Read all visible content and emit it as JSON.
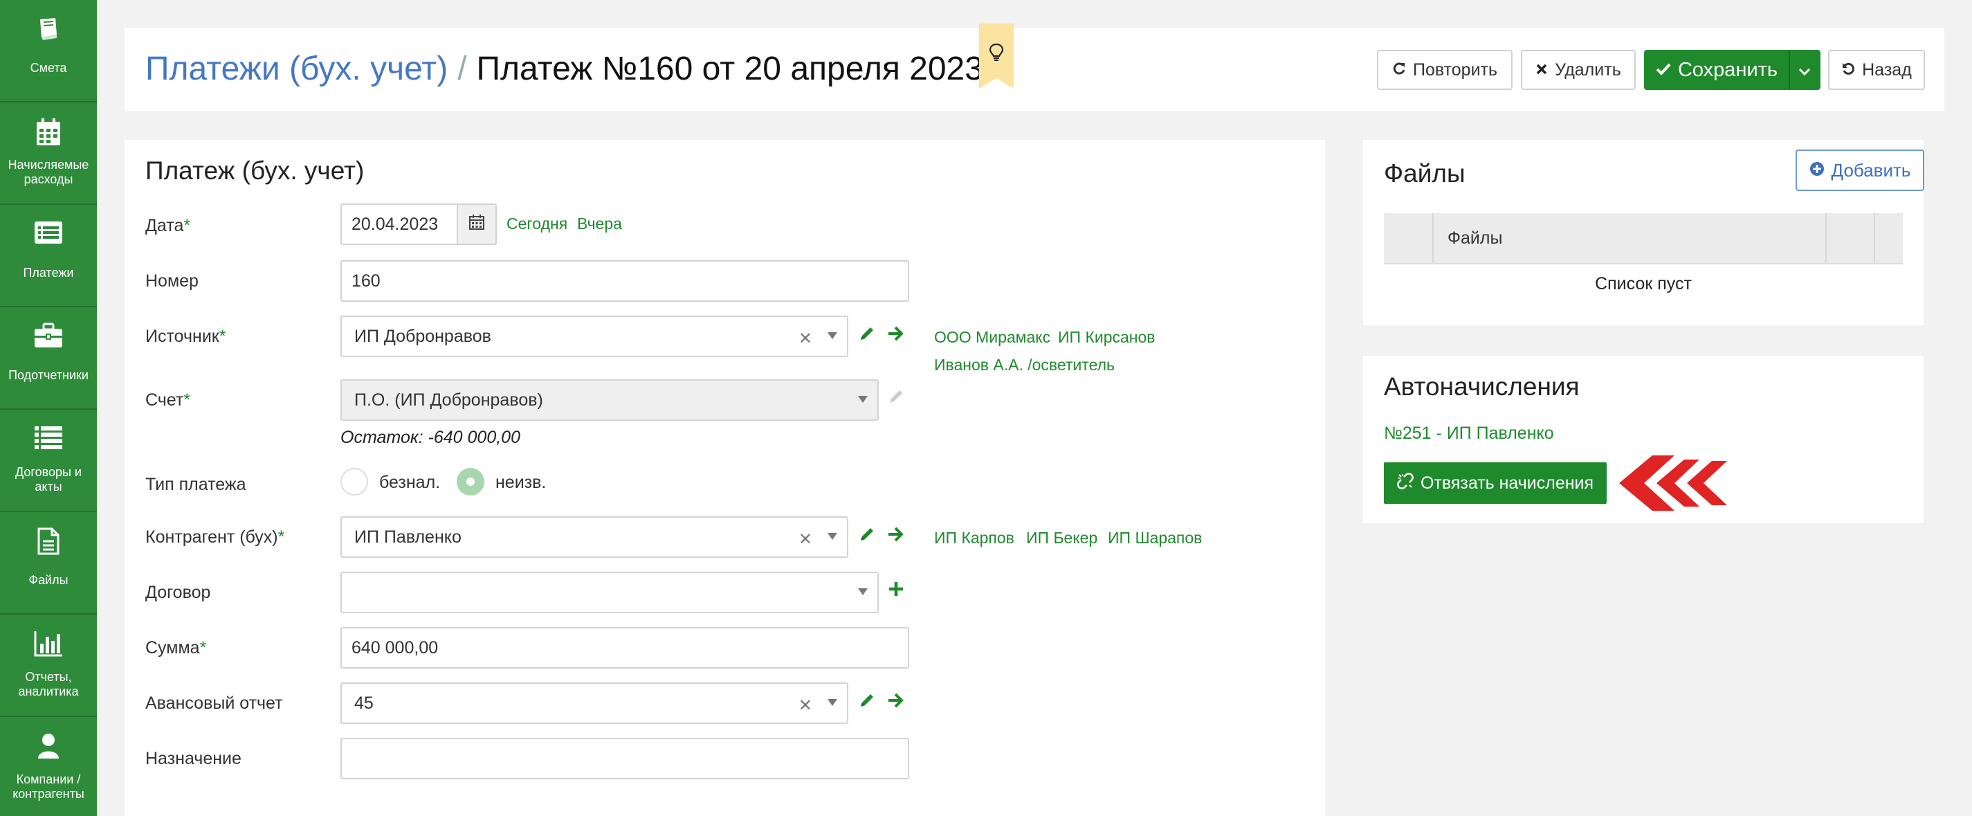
{
  "sidebar": {
    "items": [
      {
        "icon": "book-icon",
        "label": "Смета"
      },
      {
        "icon": "calendar-icon",
        "label": "Начисляемые расходы"
      },
      {
        "icon": "list-card-icon",
        "label": "Платежи"
      },
      {
        "icon": "briefcase-icon",
        "label": "Подотчетники"
      },
      {
        "icon": "list-icon",
        "label": "Договоры и акты"
      },
      {
        "icon": "file-icon",
        "label": "Файлы"
      },
      {
        "icon": "bar-chart-icon",
        "label": "Отчеты, аналитика"
      },
      {
        "icon": "user-icon",
        "label": "Компании / контрагенты"
      }
    ]
  },
  "header": {
    "breadcrumb_link": "Платежи (бух. учет)",
    "separator": "/",
    "title": "Платеж №160 от 20 апреля 2023",
    "buttons": {
      "repeat": "Повторить",
      "delete": "Удалить",
      "save": "Сохранить",
      "back": "Назад"
    }
  },
  "form": {
    "title": "Платеж (бух. учет)",
    "required_mark": "*",
    "date": {
      "label": "Дата",
      "value": "20.04.2023",
      "today": "Сегодня",
      "yesterday": "Вчера"
    },
    "number": {
      "label": "Номер",
      "value": "160"
    },
    "source": {
      "label": "Источник",
      "value": "ИП Добронравов",
      "suggestions": [
        "ООО Мирамакс",
        "ИП Кирсанов",
        "Иванов А.А. /осветитель"
      ]
    },
    "account": {
      "label": "Счет",
      "value": "П.О. (ИП Добронравов)",
      "balance": "Остаток: -640 000,00"
    },
    "payment_type": {
      "label": "Тип платежа",
      "options": [
        "безнал.",
        "неизв."
      ],
      "selected": "неизв."
    },
    "counterparty": {
      "label": "Контрагент (бух)",
      "value": "ИП Павленко",
      "suggestions": [
        "ИП Карпов",
        "ИП Бекер",
        "ИП Шарапов"
      ]
    },
    "contract": {
      "label": "Договор",
      "value": ""
    },
    "amount": {
      "label": "Сумма",
      "value": "640 000,00"
    },
    "advance_report": {
      "label": "Авансовый отчет",
      "value": "45"
    },
    "purpose": {
      "label": "Назначение",
      "value": ""
    }
  },
  "files": {
    "title": "Файлы",
    "add_label": "Добавить",
    "column": "Файлы",
    "empty": "Список пуст"
  },
  "auto": {
    "title": "Автоначисления",
    "item": "№251 - ИП Павленко",
    "unlink_label": "Отвязать начисления"
  },
  "colors": {
    "sidebar": "#2e8b3a",
    "accent_green": "#1f8a2c",
    "link_blue": "#4577c4",
    "arrow_red": "#e02424",
    "bookmark": "#fbe3a0"
  }
}
